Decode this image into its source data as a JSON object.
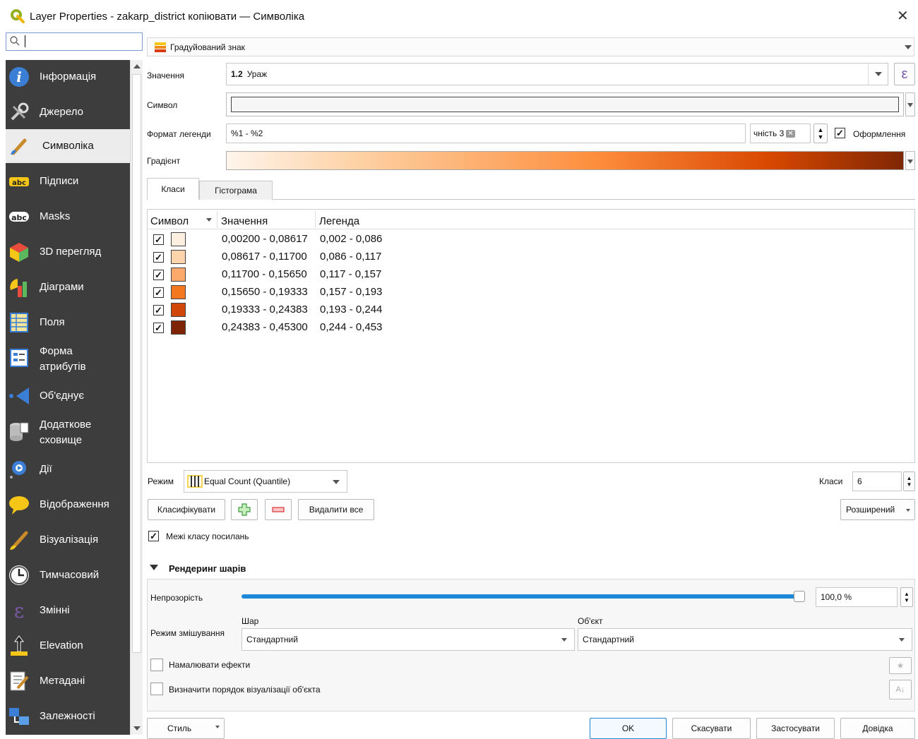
{
  "window": {
    "title": "Layer Properties - zakarp_district копіювати — Символіка"
  },
  "search": {
    "placeholder": ""
  },
  "sidebar": {
    "items": [
      {
        "label": "Інформація"
      },
      {
        "label": "Джерело"
      },
      {
        "label": "Символіка"
      },
      {
        "label": "Підписи"
      },
      {
        "label": "Masks"
      },
      {
        "label": "3D перегляд"
      },
      {
        "label": "Діаграми"
      },
      {
        "label": "Поля"
      },
      {
        "label": "Форма атрибутів"
      },
      {
        "label": "Об'єднує"
      },
      {
        "label": "Додаткове сховище"
      },
      {
        "label": "Дії"
      },
      {
        "label": "Відображення"
      },
      {
        "label": "Візуалізація"
      },
      {
        "label": "Тимчасовий"
      },
      {
        "label": "Змінні"
      },
      {
        "label": "Elevation"
      },
      {
        "label": "Метадані"
      },
      {
        "label": "Залежності"
      }
    ]
  },
  "renderer": {
    "type": "Градуйований знак"
  },
  "form": {
    "value_label": "Значення",
    "value_field_prefix": "1.2",
    "value_field": "Ураж",
    "symbol_label": "Символ",
    "legend_format_label": "Формат легенди",
    "legend_format": "%1 - %2",
    "precision_text": "чність 3",
    "format_checkbox_label": "Оформлення",
    "gradient_label": "Градієнт"
  },
  "tabs": [
    {
      "label": "Класи"
    },
    {
      "label": "Гістограма"
    }
  ],
  "table": {
    "headers": {
      "symbol": "Символ",
      "value": "Значення",
      "legend": "Легенда"
    },
    "rows": [
      {
        "value": "0,00200 - 0,08617",
        "legend": "0,002 - 0,086",
        "color": "#fef0e1"
      },
      {
        "value": "0,08617 - 0,11700",
        "legend": "0,086 - 0,117",
        "color": "#fdd4ac"
      },
      {
        "value": "0,11700 - 0,15650",
        "legend": "0,117 - 0,157",
        "color": "#fca96b"
      },
      {
        "value": "0,15650 - 0,19333",
        "legend": "0,157 - 0,193",
        "color": "#f3781f"
      },
      {
        "value": "0,19333 - 0,24383",
        "legend": "0,193 - 0,244",
        "color": "#d14709"
      },
      {
        "value": "0,24383 - 0,45300",
        "legend": "0,244 - 0,453",
        "color": "#7e2304"
      }
    ]
  },
  "mode": {
    "label": "Режим",
    "value": "Equal Count (Quantile)",
    "classes_label": "Класи",
    "classes_value": "6"
  },
  "buttons": {
    "classify": "Класифікувати",
    "delete_all": "Видалити все",
    "advanced": "Розширений",
    "style": "Стиль",
    "ok": "OK",
    "cancel": "Скасувати",
    "apply": "Застосувати",
    "help": "Довідка"
  },
  "link_classes": {
    "label": "Межі класу посилань"
  },
  "layer_rendering": {
    "title": "Рендеринг шарів",
    "opacity_label": "Непрозорість",
    "opacity_value": "100,0 %",
    "opacity_fraction": 1.0,
    "blend_label": "Режим змішування",
    "layer_label": "Шар",
    "object_label": "Об'єкт",
    "layer_blend": "Стандартний",
    "object_blend": "Стандартний",
    "draw_effects": "Намалювати ефекти",
    "render_order": "Визначити порядок візуалізації об'єкта"
  },
  "colors": {
    "accent": "#1e88d6",
    "sidebar_bg": "#3d3d3d",
    "gradient_start": "#fff5eb",
    "gradient_end": "#7f2704"
  }
}
